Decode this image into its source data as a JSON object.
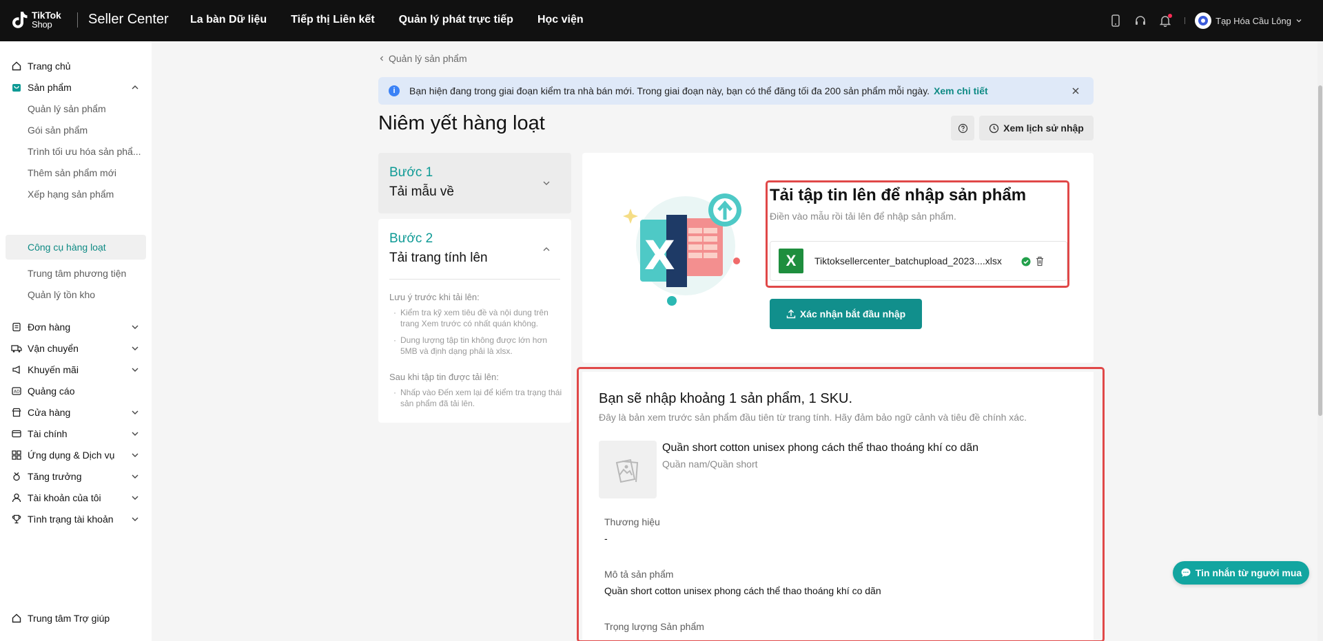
{
  "header": {
    "logo_line1": "TikTok",
    "logo_line2": "Shop",
    "brand": "Seller Center",
    "nav": [
      "La bàn Dữ liệu",
      "Tiếp thị Liên kết",
      "Quản lý phát trực tiếp",
      "Học viện"
    ],
    "user_name": "Tạp Hóa Cầu Lông"
  },
  "sidebar": {
    "items": [
      {
        "label": "Trang chủ",
        "icon": "home-icon"
      },
      {
        "label": "Sản phẩm",
        "icon": "product-icon"
      },
      {
        "label": "Đơn hàng",
        "icon": "order-icon"
      },
      {
        "label": "Vận chuyển",
        "icon": "shipping-icon"
      },
      {
        "label": "Khuyến mãi",
        "icon": "megaphone-icon"
      },
      {
        "label": "Quảng cáo",
        "icon": "ads-icon"
      },
      {
        "label": "Cửa hàng",
        "icon": "store-icon"
      },
      {
        "label": "Tài chính",
        "icon": "finance-icon"
      },
      {
        "label": "Ứng dụng & Dịch vụ",
        "icon": "apps-icon"
      },
      {
        "label": "Tăng trưởng",
        "icon": "medal-icon"
      },
      {
        "label": "Tài khoản của tôi",
        "icon": "user-icon"
      },
      {
        "label": "Tình trạng tài khoản",
        "icon": "trophy-icon"
      },
      {
        "label": "Trung tâm Trợ giúp",
        "icon": "help-icon"
      }
    ],
    "sub_items": [
      "Quản lý sản phẩm",
      "Gói sản phẩm",
      "Trình tối ưu hóa sản phẩ...",
      "Thêm sản phẩm mới",
      "Xếp hạng sản phẩm",
      "Công cụ hàng loạt",
      "Trung tâm phương tiện",
      "Quản lý tồn kho"
    ],
    "active_sub": "Công cụ hàng loạt"
  },
  "main": {
    "back_label": "Quản lý sản phẩm",
    "notice_text": "Bạn hiện đang trong giai đoạn kiểm tra nhà bán mới. Trong giai đoạn này, bạn có thể đăng tối đa 200 sản phẩm mỗi ngày.",
    "notice_link": "Xem chi tiết",
    "title": "Niêm yết hàng loạt",
    "history_label": "Xem lịch sử nhập",
    "step1": {
      "num": "Bước 1",
      "name": "Tải mẫu về"
    },
    "step2": {
      "num": "Bước 2",
      "name": "Tải trang tính lên",
      "before_heading": "Lưu ý trước khi tải lên:",
      "before_items": [
        "Kiểm tra kỹ xem tiêu đề và nội dung trên trang Xem trước có nhất quán không.",
        "Dung lượng tập tin không được lớn hơn 5MB và định dạng phải là xlsx."
      ],
      "after_heading": "Sau khi tập tin được tải lên:",
      "after_items": [
        "Nhấp vào Đến xem lại để kiểm tra trạng thái sản phẩm đã tải lên."
      ]
    },
    "upload": {
      "title": "Tải tập tin lên để nhập sản phẩm",
      "subtitle": "Điền vào mẫu rồi tải lên để nhập sản phẩm.",
      "file_badge": "X",
      "file_name": "Tiktoksellercenter_batchupload_2023....xlsx",
      "confirm_label": "Xác nhận bắt đầu nhập"
    },
    "preview": {
      "title": "Bạn sẽ nhập khoảng 1 sản phẩm, 1 SKU.",
      "subtitle": "Đây là bản xem trước sản phẩm đầu tiên từ trang tính. Hãy đảm bảo ngữ cảnh và tiêu đề chính xác.",
      "product_name": "Quần short cotton unisex phong cách thể thao thoáng khí co dãn",
      "category": "Quần nam/Quần short",
      "brand_label": "Thương hiệu",
      "brand_value": "-",
      "desc_label": "Mô tả sản phẩm",
      "desc_value": "Quần short cotton unisex phong cách thể thao thoáng khí co dãn",
      "weight_label": "Trọng lượng Sản phẩm"
    }
  },
  "chat_label": "Tin nhắn từ người mua",
  "colors": {
    "accent": "#0e9a95",
    "topbar": "#111111",
    "highlight": "#e04848"
  }
}
